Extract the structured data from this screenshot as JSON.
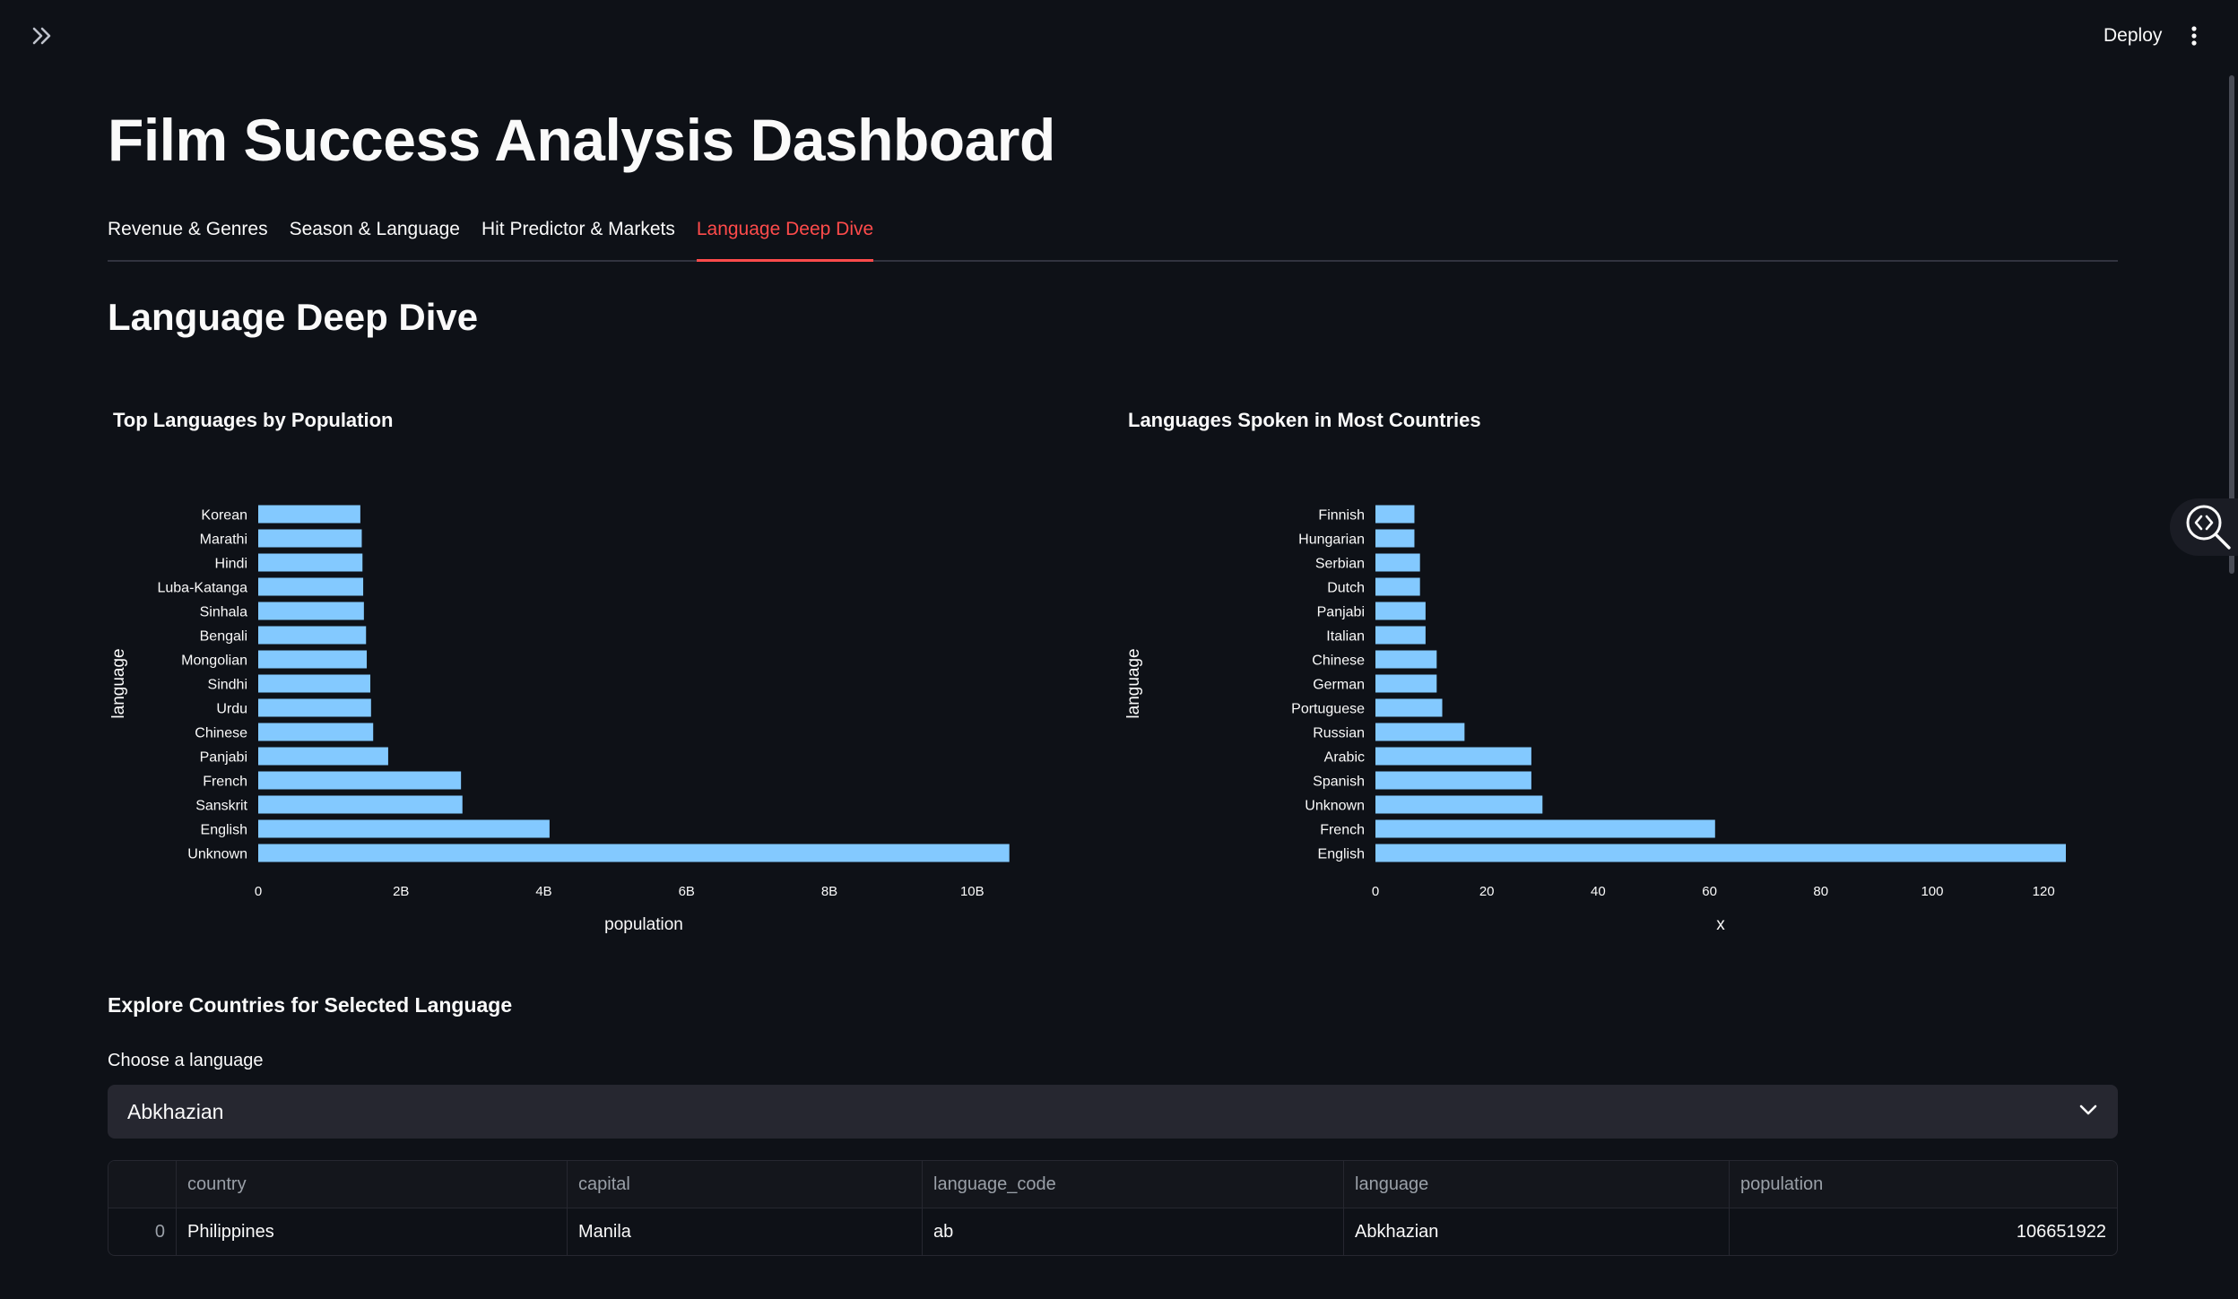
{
  "header": {
    "deploy_label": "Deploy",
    "icons": [
      "chevrons-right-icon",
      "vertical-dots-icon",
      "code-search-icon"
    ]
  },
  "page": {
    "title": "Film Success Analysis Dashboard",
    "section_title": "Language Deep Dive"
  },
  "tabs": [
    {
      "label": "Revenue & Genres",
      "active": false
    },
    {
      "label": "Season & Language",
      "active": false
    },
    {
      "label": "Hit Predictor & Markets",
      "active": false
    },
    {
      "label": "Language Deep Dive",
      "active": true
    }
  ],
  "colors": {
    "background": "#0e1117",
    "accent": "#ff4b4b",
    "bar": "#83c9ff"
  },
  "chart_data": [
    {
      "type": "bar",
      "orientation": "horizontal",
      "title": "Top Languages by Population",
      "xlabel": "population",
      "ylabel": "language",
      "categories": [
        "Korean",
        "Marathi",
        "Hindi",
        "Luba-Katanga",
        "Sinhala",
        "Bengali",
        "Mongolian",
        "Sindhi",
        "Urdu",
        "Chinese",
        "Panjabi",
        "French",
        "Sanskrit",
        "English",
        "Unknown"
      ],
      "values": [
        1430000000,
        1450000000,
        1460000000,
        1470000000,
        1480000000,
        1510000000,
        1520000000,
        1570000000,
        1580000000,
        1610000000,
        1820000000,
        2840000000,
        2860000000,
        4080000000,
        10520000000
      ],
      "ticks": [
        "0",
        "2B",
        "4B",
        "6B",
        "8B",
        "10B"
      ],
      "xlim": [
        0,
        10800000000
      ],
      "grid": false
    },
    {
      "type": "bar",
      "orientation": "horizontal",
      "title": "Languages Spoken in Most Countries",
      "xlabel": "x",
      "ylabel": "language",
      "categories": [
        "Finnish",
        "Hungarian",
        "Serbian",
        "Dutch",
        "Panjabi",
        "Italian",
        "Chinese",
        "German",
        "Portuguese",
        "Russian",
        "Arabic",
        "Spanish",
        "Unknown",
        "French",
        "English"
      ],
      "values": [
        7,
        7,
        8,
        8,
        9,
        9,
        11,
        11,
        12,
        16,
        28,
        28,
        30,
        61,
        124
      ],
      "ticks": [
        "0",
        "20",
        "40",
        "60",
        "80",
        "100",
        "120"
      ],
      "xlim": [
        0,
        124
      ],
      "grid": false
    }
  ],
  "explore": {
    "title": "Explore Countries for Selected Language",
    "select_label": "Choose a language",
    "selected": "Abkhazian"
  },
  "table": {
    "columns": [
      "",
      "country",
      "capital",
      "language_code",
      "language",
      "population"
    ],
    "rows": [
      [
        "0",
        "Philippines",
        "Manila",
        "ab",
        "Abkhazian",
        "106651922"
      ]
    ]
  }
}
